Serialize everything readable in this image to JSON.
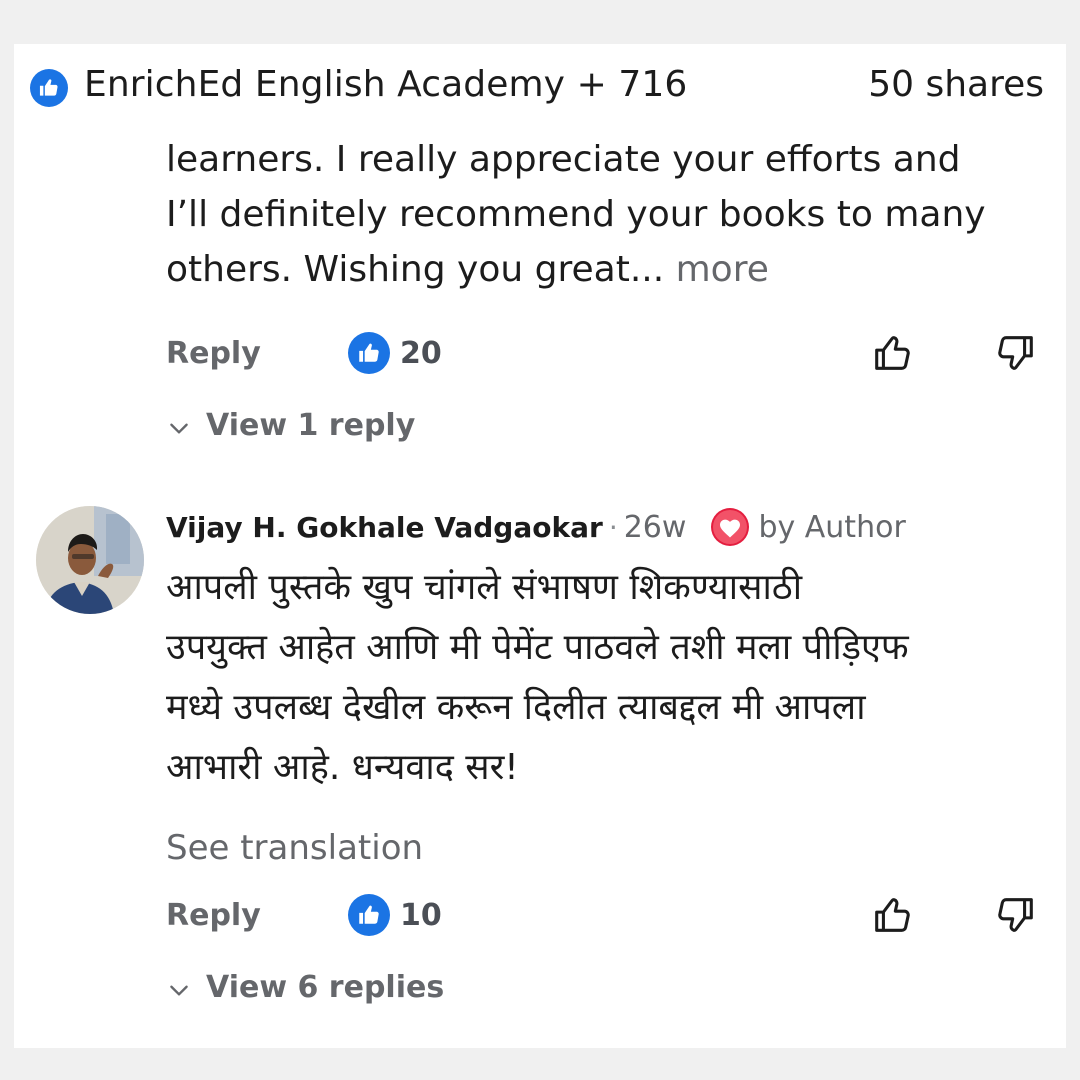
{
  "header": {
    "page_name": "EnrichEd English Academy + 716",
    "shares": "50 shares"
  },
  "comment1": {
    "text_lines": [
      "learners. I really appreciate your efforts and",
      "I’ll definitely recommend your books to many",
      "others. Wishing you great..."
    ],
    "more_label": "more",
    "reply_label": "Reply",
    "like_count": "20",
    "view_replies_label": "View 1 reply"
  },
  "comment2": {
    "author": "Vijay H. Gokhale Vadgaokar",
    "separator": "·",
    "time": "26w",
    "author_reaction_label": "by Author",
    "text_lines": [
      "आपली पुस्तके खुप चांगले संभाषण शिकण्यासाठी",
      "उपयुक्त आहेत आणि मी  पेमेंट पाठवले तशी मला पीड़िएफ",
      "मध्ये उपलब्ध देखील करून दिलीत त्याबद्दल मी आपला",
      "आभारी आहे. धन्यवाद सर!"
    ],
    "see_translation_label": "See translation",
    "reply_label": "Reply",
    "like_count": "10",
    "view_replies_label": "View 6 replies"
  },
  "colors": {
    "like_blue": "#1b74e4",
    "heart_red": "#e41e3f",
    "muted_text": "#65676b"
  },
  "icons": [
    "thumbs-up-reaction-icon",
    "thumbs-up-outline-icon",
    "thumbs-down-outline-icon",
    "chevron-down-icon",
    "heart-icon"
  ]
}
